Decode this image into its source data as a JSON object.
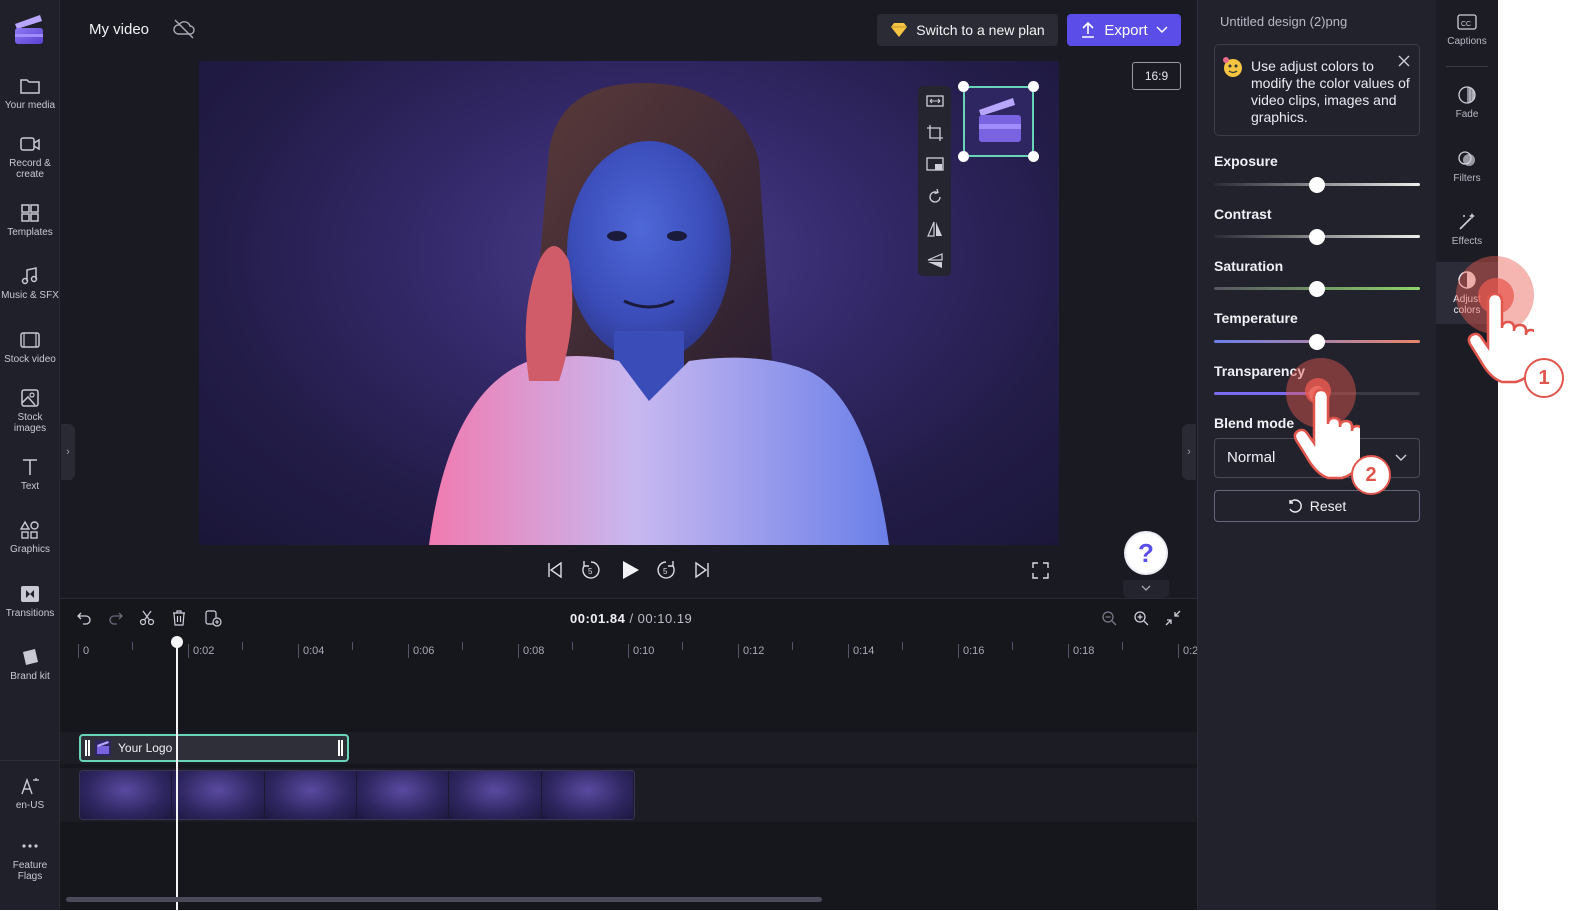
{
  "app": {
    "project_title": "My video",
    "plan_button": "Switch to a new plan",
    "export_button": "Export",
    "aspect_ratio": "16:9"
  },
  "left_rail": {
    "items": [
      {
        "label": "Your media",
        "icon": "folder-icon"
      },
      {
        "label": "Record &\ncreate",
        "icon": "camera-icon"
      },
      {
        "label": "Templates",
        "icon": "templates-icon"
      },
      {
        "label": "Music & SFX",
        "icon": "music-icon"
      },
      {
        "label": "Stock video",
        "icon": "film-icon"
      },
      {
        "label": "Stock\nimages",
        "icon": "image-icon"
      },
      {
        "label": "Text",
        "icon": "text-icon"
      },
      {
        "label": "Graphics",
        "icon": "shapes-icon"
      },
      {
        "label": "Transitions",
        "icon": "transition-icon"
      },
      {
        "label": "Brand kit",
        "icon": "brand-kit-icon"
      },
      {
        "label": "en-US",
        "icon": "language-icon"
      },
      {
        "label": "Feature\nFlags",
        "icon": "more-icon"
      }
    ]
  },
  "timeline": {
    "current_time": "00:01.84",
    "total_time": "/ 00:10.19",
    "ticks": [
      "0",
      "0:02",
      "0:04",
      "0:06",
      "0:08",
      "0:10",
      "0:12",
      "0:14",
      "0:16",
      "0:18",
      "0:2"
    ],
    "logo_clip_label": "Your Logo",
    "playhead_fraction": 0.18
  },
  "right_panel": {
    "title": "Untitled design (2)png",
    "tip_text": "Use adjust colors to modify the color values of video clips, images and graphics.",
    "sliders": [
      {
        "label": "Exposure",
        "value": 0.5
      },
      {
        "label": "Contrast",
        "value": 0.5
      },
      {
        "label": "Saturation",
        "value": 0.5
      },
      {
        "label": "Temperature",
        "value": 0.5
      },
      {
        "label": "Transparency",
        "value": 0.5
      }
    ],
    "blend_mode_label": "Blend mode",
    "blend_mode_value": "Normal",
    "reset_button": "Reset"
  },
  "right_rail": {
    "items": [
      {
        "label": "Captions",
        "icon": "captions-icon"
      },
      {
        "label": "Fade",
        "icon": "fade-icon"
      },
      {
        "label": "Filters",
        "icon": "filters-icon"
      },
      {
        "label": "Effects",
        "icon": "effects-icon"
      },
      {
        "label": "Adjust\ncolors",
        "icon": "adjust-colors-icon"
      }
    ]
  },
  "callouts": [
    "1",
    "2"
  ],
  "colors": {
    "accent": "#5b4ee8",
    "selection": "#6ad4b8",
    "callout": "#e0564c"
  }
}
